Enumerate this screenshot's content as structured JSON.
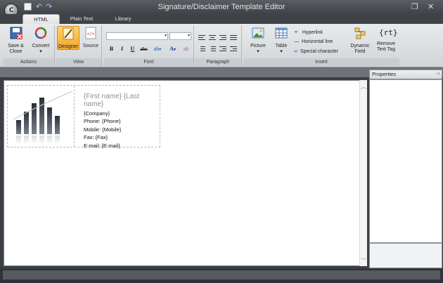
{
  "app": {
    "title": "Signature/Disclaimer Template Editor",
    "orb_label": "C"
  },
  "tabs": [
    {
      "label": "HTML",
      "active": true
    },
    {
      "label": "Plain Text",
      "active": false
    },
    {
      "label": "Library",
      "active": false
    }
  ],
  "ribbon": {
    "actions": {
      "label": "Actions",
      "save_close": "Save &\nClose",
      "convert": "Convert"
    },
    "view": {
      "label": "View",
      "designer": "Designer",
      "source": "Source"
    },
    "font": {
      "label": "Font",
      "font_name": "",
      "font_size": ""
    },
    "paragraph": {
      "label": "Paragraph"
    },
    "insert": {
      "label": "Insert",
      "picture": "Picture",
      "table": "Table",
      "hyperlink": "Hyperlink",
      "horizontal_line": "Horizontal line",
      "special_character": "Special character",
      "dynamic_field": "Dynamic\nField",
      "remove_text_tag": "Remove\nText Tag",
      "rt_glyph": "{rt}"
    }
  },
  "signature": {
    "name": "{First name} {Last name}",
    "lines": [
      "{Company}",
      "Phone: {Phone}",
      "Mobile: {Mobile}",
      "Fax: {Fax}",
      "E-mail: {E-mail}"
    ],
    "bar_heights": [
      0.35,
      0.55,
      0.75,
      0.9,
      0.65,
      0.45
    ]
  },
  "properties": {
    "title": "Properties"
  },
  "colors": {
    "accent": "#f4a52b",
    "chrome": "#3f4347"
  }
}
